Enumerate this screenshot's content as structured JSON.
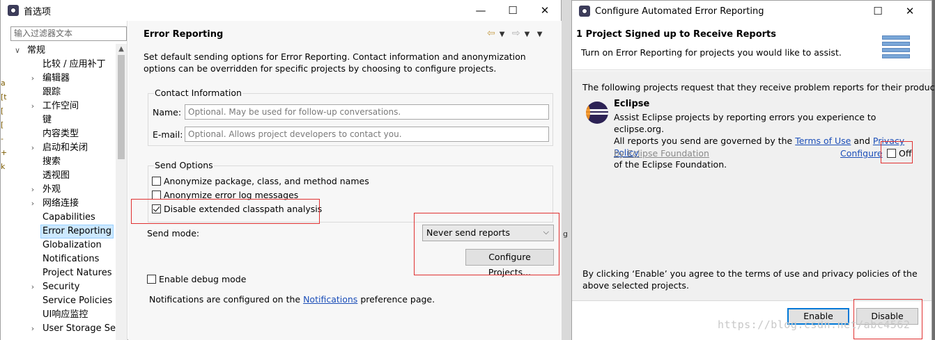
{
  "preferences": {
    "title": "首选项",
    "filter_placeholder": "输入过滤器文本",
    "tree": [
      {
        "label": "常规",
        "level": 0,
        "arrow": "expanded"
      },
      {
        "label": "比较 / 应用补丁",
        "level": 1,
        "arrow": ""
      },
      {
        "label": "编辑器",
        "level": 1,
        "arrow": "collapsed"
      },
      {
        "label": "跟踪",
        "level": 1,
        "arrow": ""
      },
      {
        "label": "工作空间",
        "level": 1,
        "arrow": "collapsed"
      },
      {
        "label": "键",
        "level": 1,
        "arrow": ""
      },
      {
        "label": "内容类型",
        "level": 1,
        "arrow": ""
      },
      {
        "label": "启动和关闭",
        "level": 1,
        "arrow": "collapsed"
      },
      {
        "label": "搜索",
        "level": 1,
        "arrow": ""
      },
      {
        "label": "透视图",
        "level": 1,
        "arrow": ""
      },
      {
        "label": "外观",
        "level": 1,
        "arrow": "collapsed"
      },
      {
        "label": "网络连接",
        "level": 1,
        "arrow": "collapsed"
      },
      {
        "label": "Capabilities",
        "level": 1,
        "arrow": ""
      },
      {
        "label": "Error Reporting",
        "level": 1,
        "arrow": "",
        "selected": true
      },
      {
        "label": "Globalization",
        "level": 1,
        "arrow": ""
      },
      {
        "label": "Notifications",
        "level": 1,
        "arrow": ""
      },
      {
        "label": "Project Natures",
        "level": 1,
        "arrow": ""
      },
      {
        "label": "Security",
        "level": 1,
        "arrow": "collapsed"
      },
      {
        "label": "Service Policies",
        "level": 1,
        "arrow": ""
      },
      {
        "label": "UI响应监控",
        "level": 1,
        "arrow": ""
      },
      {
        "label": "User Storage Serv",
        "level": 1,
        "arrow": "collapsed"
      }
    ],
    "page_title": "Error Reporting",
    "description": "Set default sending options for Error Reporting. Contact information and anonymization options can be overridden for specific projects by choosing to configure projects.",
    "contact": {
      "group_title": "Contact Information",
      "name_label": "Name:",
      "name_placeholder": "Optional. May be used for follow-up conversations.",
      "email_label": "E-mail:",
      "email_placeholder": "Optional. Allows project developers to contact you."
    },
    "send_options": {
      "group_title": "Send Options",
      "options": [
        {
          "label": "Anonymize package, class, and method names",
          "checked": false
        },
        {
          "label": "Anonymize error log messages",
          "checked": false
        },
        {
          "label": "Disable extended classpath analysis",
          "checked": true
        }
      ]
    },
    "send_mode_label": "Send mode:",
    "send_mode_value": "Never send reports",
    "configure_projects_label": "Configure Projects...",
    "debug_label": "Enable debug mode",
    "notifications_prefix": "Notifications are configured on the",
    "notifications_link": "Notifications",
    "notifications_suffix": "preference page."
  },
  "dialog": {
    "title": "Configure Automated Error Reporting",
    "header_title": "1 Project Signed up to Receive Reports",
    "header_subtitle": "Turn on Error Reporting for projects you would like to assist.",
    "intro": "The following projects request that they receive problem reports for their products:",
    "project": {
      "name": "Eclipse",
      "desc_line1": "Assist Eclipse projects by reporting errors you experience to eclipse.org.",
      "desc_line2_prefix": "All reports you send are governed by the",
      "terms_link": "Terms of Use",
      "and": "and",
      "privacy_link": "Privacy Policy",
      "desc_line3": "of the Eclipse Foundation.",
      "by_line": "by Eclipse Foundation",
      "configure_link": "Configure",
      "toggle_label": "Off",
      "toggle_checked": false
    },
    "consent": "By clicking ‘Enable’ you agree to the terms of use and privacy policies of the above selected projects.",
    "enable_label": "Enable",
    "disable_label": "Disable"
  },
  "watermark": "https://blog.csdn.net/abc4562",
  "colors": {
    "link": "#1b4eb8",
    "highlight_box": "#e03030",
    "selection": "#cce8ff",
    "primary_button_border": "#0078d7"
  },
  "icons": {
    "back": "arrow-left-icon",
    "forward": "arrow-right-icon",
    "menu": "chevron-down-icon"
  }
}
